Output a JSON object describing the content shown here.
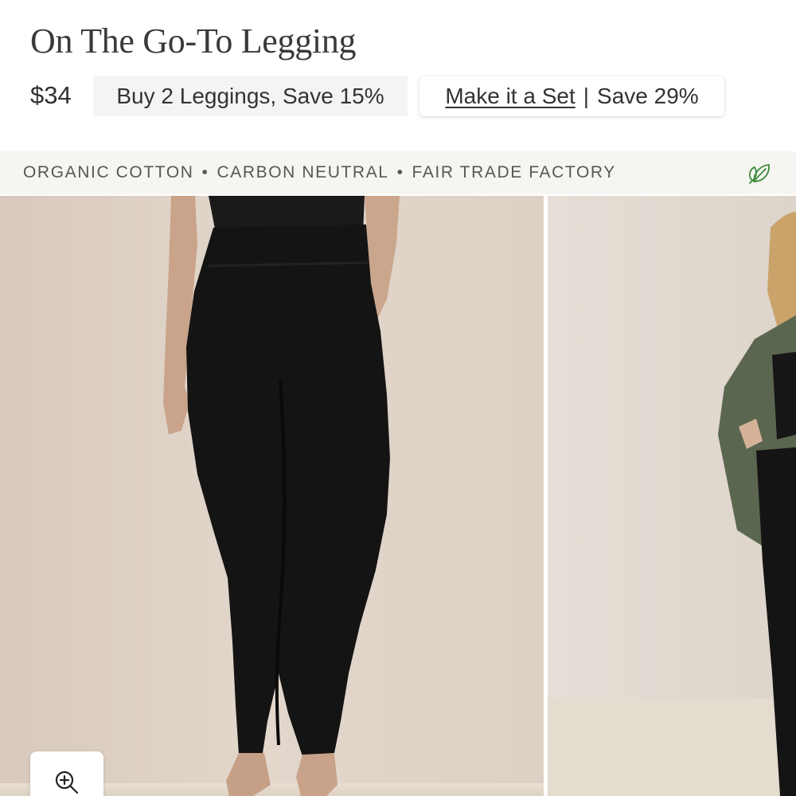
{
  "product": {
    "title": "On The Go-To Legging",
    "price": "$34"
  },
  "promos": {
    "bundle": "Buy 2 Leggings, Save 15%",
    "set_link": "Make it a Set",
    "set_separator": "|",
    "set_save": "Save 29%"
  },
  "attributes": {
    "items": [
      "ORGANIC COTTON",
      "CARBON NEUTRAL",
      "FAIR TRADE FACTORY"
    ],
    "separator": "•",
    "icon": "leaf-icon",
    "icon_color": "#3e8a3a"
  },
  "gallery": {
    "zoom_icon": "zoom-in-icon"
  },
  "colors": {
    "legging": "#141414",
    "wall": "#ddd1c6",
    "jacket": "#5b6650",
    "hair": "#c9a36a",
    "carpet": "#e4dccf"
  }
}
